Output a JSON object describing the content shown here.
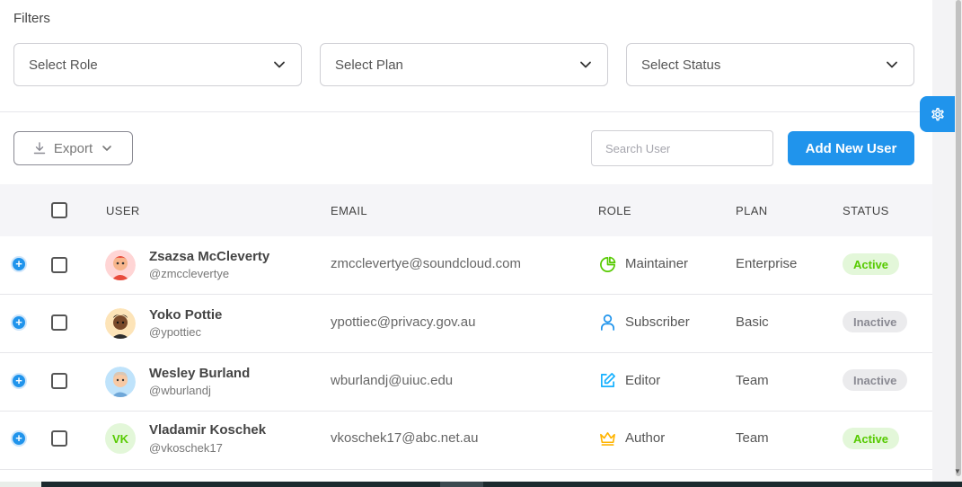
{
  "filters": {
    "title": "Filters",
    "role_select": "Select Role",
    "plan_select": "Select Plan",
    "status_select": "Select Status"
  },
  "toolbar": {
    "export_label": "Export",
    "search_placeholder": "Search User",
    "add_user_label": "Add New User"
  },
  "table": {
    "headers": [
      "USER",
      "EMAIL",
      "ROLE",
      "PLAN",
      "STATUS"
    ],
    "rows": [
      {
        "name": "Zsazsa McCleverty",
        "handle": "@zmcclevertye",
        "email": "zmcclevertye@soundcloud.com",
        "role": "Maintainer",
        "role_icon": "pie-chart-icon",
        "plan": "Enterprise",
        "status": "Active"
      },
      {
        "name": "Yoko Pottie",
        "handle": "@ypottiec",
        "email": "ypottiec@privacy.gov.au",
        "role": "Subscriber",
        "role_icon": "user-icon",
        "plan": "Basic",
        "status": "Inactive"
      },
      {
        "name": "Wesley Burland",
        "handle": "@wburlandj",
        "email": "wburlandj@uiuc.edu",
        "role": "Editor",
        "role_icon": "edit-icon",
        "plan": "Team",
        "status": "Inactive"
      },
      {
        "name": "Vladamir Koschek",
        "handle": "@vkoschek17",
        "avatar_initials": "VK",
        "email": "vkoschek17@abc.net.au",
        "role": "Author",
        "role_icon": "crown-icon",
        "plan": "Team",
        "status": "Active"
      }
    ]
  },
  "colors": {
    "primary": "#2094ec",
    "success": "#56ca00",
    "maintainer": "#56ca00",
    "subscriber": "#2094ec",
    "editor": "#16b1ff",
    "author": "#ffb400"
  }
}
